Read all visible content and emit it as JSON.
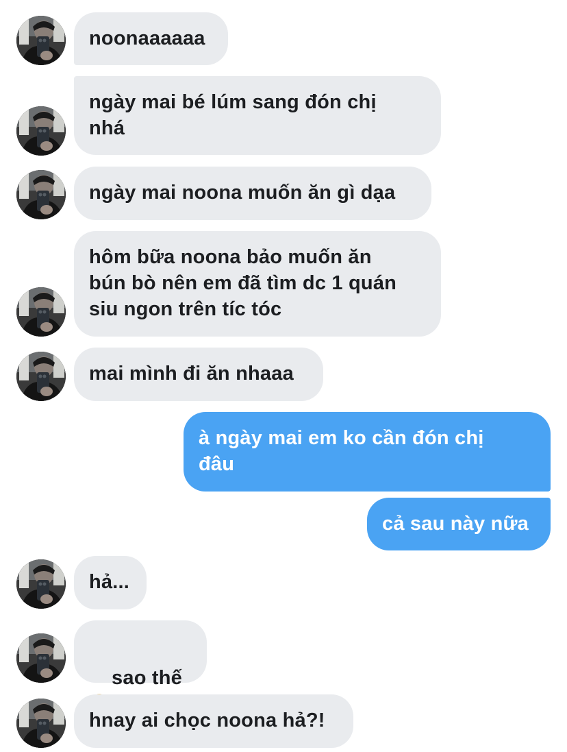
{
  "conversation": {
    "messages": [
      {
        "id": "m1",
        "side": "in",
        "text": "noonaaaaaa"
      },
      {
        "id": "m2",
        "side": "in",
        "text": "ngày mai bé lúm sang đón chị\nnhá"
      },
      {
        "id": "m3",
        "side": "in",
        "text": "ngày mai noona muốn ăn gì dạa"
      },
      {
        "id": "m4",
        "side": "in",
        "text": "hôm bữa noona bảo muốn ăn\nbún bò nên em đã tìm dc 1 quán\nsiu ngon trên tíc tóc"
      },
      {
        "id": "m5",
        "side": "in",
        "text": "mai mình đi ăn nhaaa"
      },
      {
        "id": "m6",
        "side": "out",
        "text": "à ngày mai em ko cần đón chị\nđâu"
      },
      {
        "id": "m7",
        "side": "out",
        "text": "cả sau này nữa"
      },
      {
        "id": "m8",
        "side": "in",
        "text": "hả..."
      },
      {
        "id": "m9",
        "side": "in",
        "text": "sao thế",
        "emoji": "pleading-face-emoji"
      },
      {
        "id": "m10",
        "side": "in",
        "text": "hnay ai chọc noona hả?!"
      }
    ]
  },
  "colors": {
    "incoming_bubble": "#e9ebee",
    "incoming_text": "#1c1e21",
    "outgoing_bubble": "#4aa3f3",
    "outgoing_text": "#ffffff",
    "background": "#ffffff"
  }
}
